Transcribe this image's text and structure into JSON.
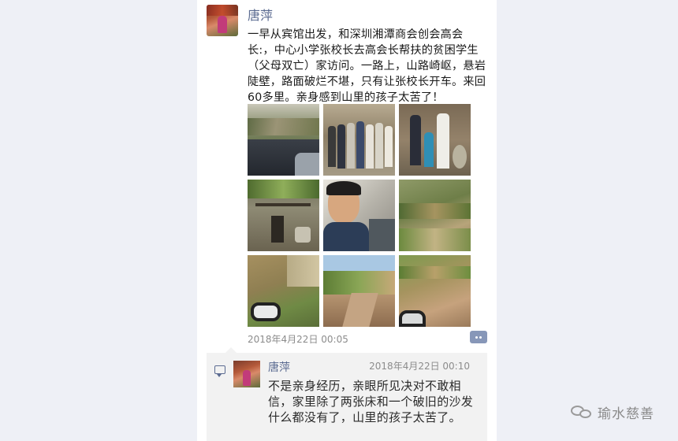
{
  "post": {
    "author": "唐萍",
    "text": "一早从宾馆出发，和深圳湘潭商会创会高会长:，中心小学张校长去高会长帮扶的贫困学生（父母双亡）家访问。一路上，山路崎岖，悬岩陡壁，路面破烂不堪，只有让张校长开车。来回60多里。亲身感到山里的孩子太苦了！",
    "timestamp": "2018年4月22日 00:05",
    "photos": [
      {
        "icon": "photo-mountain-road-from-car"
      },
      {
        "icon": "photo-group-of-people"
      },
      {
        "icon": "photo-family-at-house"
      },
      {
        "icon": "photo-old-house"
      },
      {
        "icon": "photo-man-driving"
      },
      {
        "icon": "photo-mountain-terraces"
      },
      {
        "icon": "photo-hillside-mirror"
      },
      {
        "icon": "photo-dirt-road"
      },
      {
        "icon": "photo-road-mirror"
      }
    ]
  },
  "comment": {
    "author": "唐萍",
    "time": "2018年4月22日 00:10",
    "text": "不是亲身经历，亲眼所见决对不敢相信，家里除了两张床和一个破旧的沙发什么都没有了，山里的孩子太苦了。"
  },
  "watermark": {
    "text": "瑜水慈善",
    "icon": "wechat-icon"
  },
  "colors": {
    "name_link": "#5b6b91",
    "background": "#eef0f6",
    "comment_bg": "#f2f2f2"
  }
}
